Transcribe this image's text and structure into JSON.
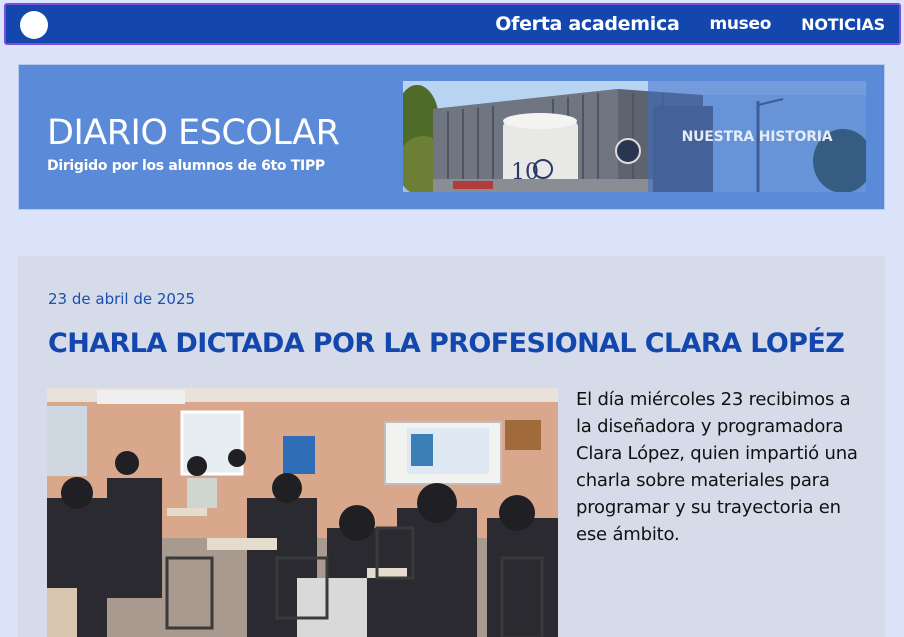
{
  "nav": {
    "links": [
      "Oferta academica",
      "museo",
      "NOTICIAS"
    ]
  },
  "banner": {
    "title": "DIARIO ESCOLAR",
    "subtitle": "Dirigido por los alumnos de 6to TIPP",
    "history_label": "NUESTRA HISTORIA"
  },
  "article": {
    "date": "23 de abril de 2025",
    "title": "CHARLA DICTADA POR LA PROFESIONAL CLARA LOPÉZ",
    "body": "El día miércoles 23 recibimos a la diseñadora y programadora Clara López, quien impartió una charla sobre materiales para programar y su trayectoria en ese ámbito.",
    "photo_icon": "classroom-photo"
  },
  "colors": {
    "navbar": "#1347ae",
    "navbar_border": "#7c4ce0",
    "page_bg": "#dbe3fb",
    "banner_bg": "#5b8bd8",
    "card_bg": "#d5dbe9",
    "headline": "#1347ae"
  }
}
